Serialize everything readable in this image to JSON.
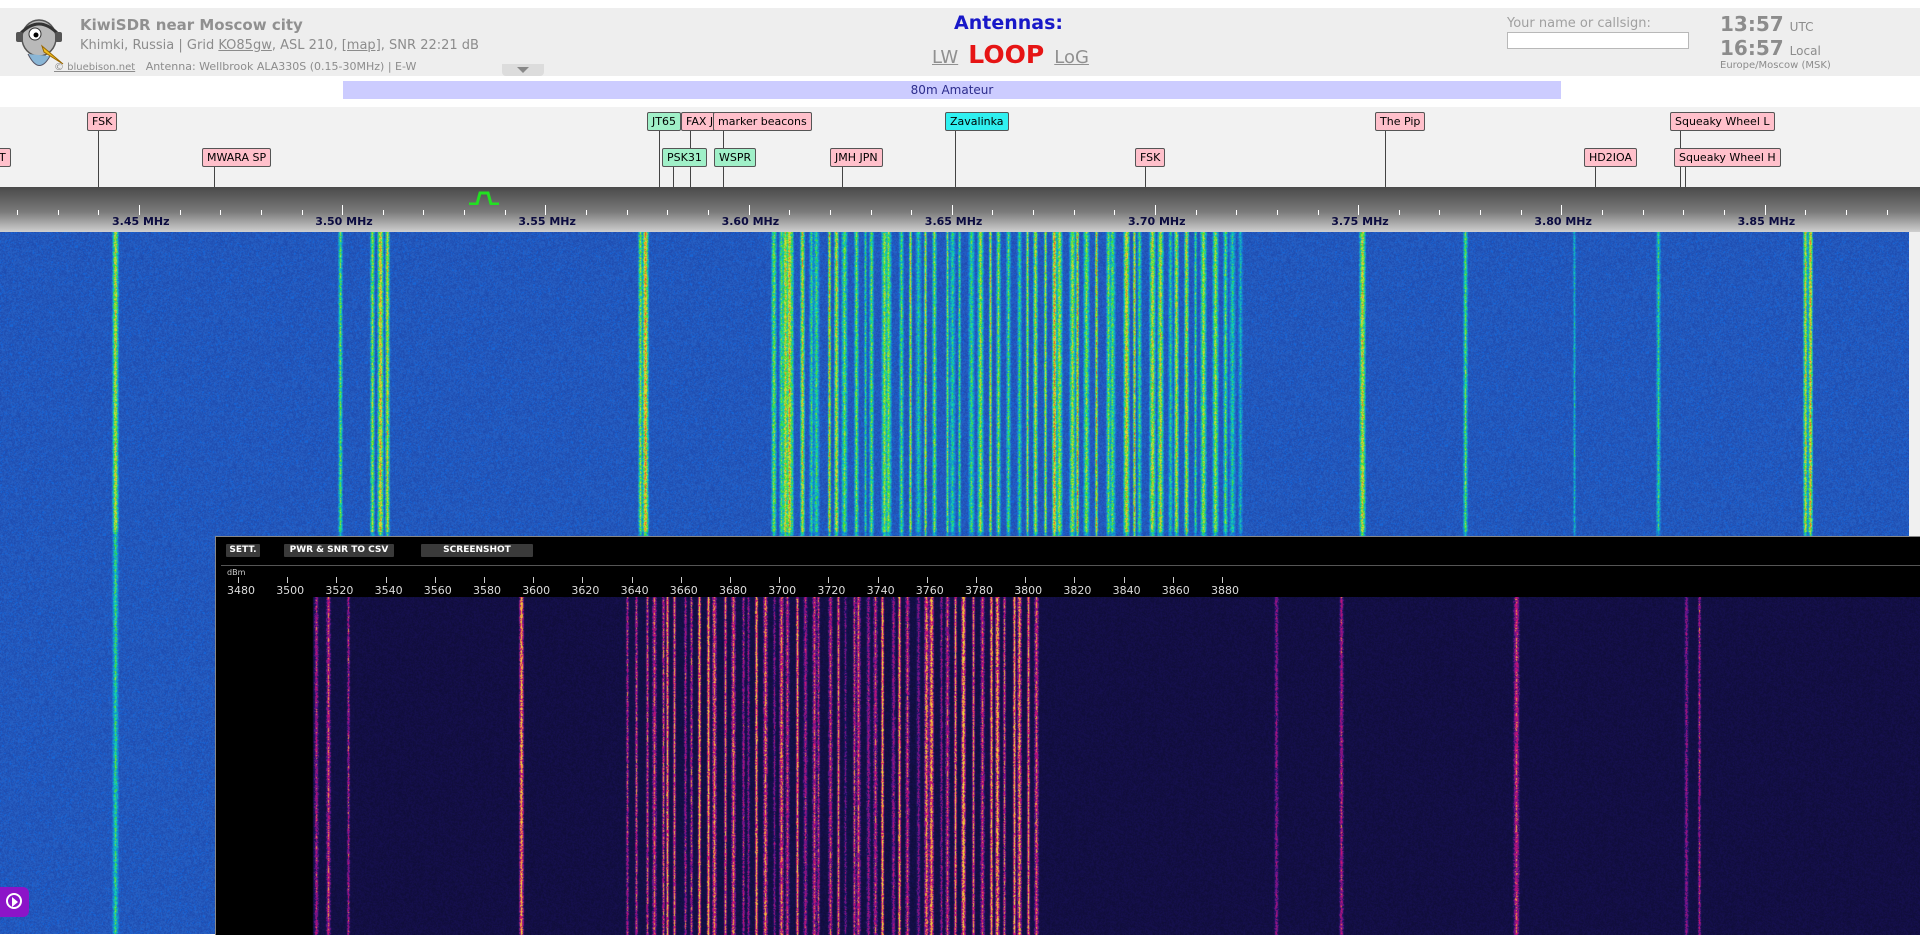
{
  "header": {
    "title": "KiwiSDR near Moscow city",
    "location": "Khimki, Russia",
    "grid_label": "Grid",
    "grid": "KO85gw",
    "asl": "ASL 210,",
    "map_link": "[map]",
    "snr": "SNR 22:21 dB",
    "credit": "© bluebison.net",
    "antenna_info": "Antenna: Wellbrook ALA330S (0.15-30MHz) | E-W"
  },
  "antennas": {
    "title": "Antennas:",
    "lw": "LW",
    "loop": "LOOP",
    "log": "LoG"
  },
  "ident": {
    "label": "Your name or callsign:",
    "value": ""
  },
  "clock": {
    "utc_time": "13:57",
    "utc_label": "UTC",
    "local_time": "16:57",
    "local_label": "Local",
    "timezone": "Europe/Moscow (MSK)"
  },
  "band_bar": "80m Amateur",
  "dx_labels": [
    {
      "text": "T",
      "color": "pink"
    },
    {
      "text": "FSK",
      "color": "pink"
    },
    {
      "text": "MWARA SP",
      "color": "pink"
    },
    {
      "text": "JT65",
      "color": "green"
    },
    {
      "text": "FAX J",
      "color": "pink"
    },
    {
      "text": "marker beacons",
      "color": "pink"
    },
    {
      "text": "PSK31",
      "color": "green"
    },
    {
      "text": "WSPR",
      "color": "green"
    },
    {
      "text": "JMH JPN",
      "color": "pink"
    },
    {
      "text": "Zavalinka",
      "color": "cyan"
    },
    {
      "text": "FSK",
      "color": "pink"
    },
    {
      "text": "The Pip",
      "color": "pink"
    },
    {
      "text": "HD2IOA",
      "color": "pink"
    },
    {
      "text": "Squeaky Wheel L",
      "color": "pink"
    },
    {
      "text": "Squeaky Wheel H",
      "color": "pink"
    }
  ],
  "scale_labels": [
    "3.45 MHz",
    "3.50 MHz",
    "3.55 MHz",
    "3.60 MHz",
    "3.65 MHz",
    "3.70 MHz",
    "3.75 MHz",
    "3.80 MHz",
    "3.85 MHz"
  ],
  "panel": {
    "buttons": [
      "SETT.",
      "PWR & SNR TO CSV",
      "SCREENSHOT"
    ],
    "dbm_label": "dBm",
    "scale": [
      "3480",
      "3500",
      "3520",
      "3540",
      "3560",
      "3580",
      "3600",
      "3620",
      "3640",
      "3660",
      "3680",
      "3700",
      "3720",
      "3740",
      "3760",
      "3780",
      "3800",
      "3820",
      "3840",
      "3860",
      "3880"
    ]
  },
  "colors": {
    "waterfall_bg": "#1e3caa",
    "waterfall_hot": "#f0e640",
    "panel_hot": "#ffc850",
    "band_bar": "#ccccff",
    "loop_active": "#e61414",
    "antenna_title": "#1818c8",
    "play_button": "#8c14c8"
  }
}
